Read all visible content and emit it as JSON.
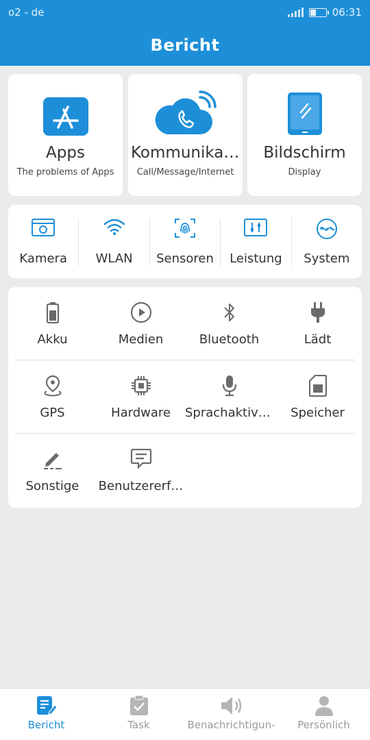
{
  "status_bar": {
    "carrier": "o2 - de",
    "time": "06:31",
    "battery_level": 0.35
  },
  "header": {
    "title": "Bericht"
  },
  "top_cards": [
    {
      "title": "Apps",
      "subtitle": "The problems of Apps",
      "icon": "app-store-icon"
    },
    {
      "title": "Kommunikati…",
      "subtitle": "Call/Message/Internet",
      "icon": "cloud-phone-icon"
    },
    {
      "title": "Bildschirm",
      "subtitle": "Display",
      "icon": "tablet-icon"
    }
  ],
  "row_items": [
    {
      "label": "Kamera",
      "icon": "camera-icon"
    },
    {
      "label": "WLAN",
      "icon": "wifi-icon"
    },
    {
      "label": "Sensoren",
      "icon": "fingerprint-icon"
    },
    {
      "label": "Leistung",
      "icon": "performance-icon"
    },
    {
      "label": "System",
      "icon": "system-icon"
    }
  ],
  "grid_items": [
    {
      "label": "Akku",
      "icon": "battery-icon"
    },
    {
      "label": "Medien",
      "icon": "play-icon"
    },
    {
      "label": "Bluetooth",
      "icon": "bluetooth-icon"
    },
    {
      "label": "Lädt",
      "icon": "plug-icon"
    },
    {
      "label": "GPS",
      "icon": "location-icon"
    },
    {
      "label": "Hardware",
      "icon": "chip-icon"
    },
    {
      "label": "Sprachaktivi…",
      "icon": "microphone-icon"
    },
    {
      "label": "Speicher",
      "icon": "sd-card-icon"
    },
    {
      "label": "Sonstige",
      "icon": "pencil-icon"
    },
    {
      "label": "Benutzererf…",
      "icon": "feedback-icon"
    }
  ],
  "bottom_nav": [
    {
      "label": "Bericht",
      "icon": "report-icon",
      "active": true
    },
    {
      "label": "Task",
      "icon": "clipboard-check-icon",
      "active": false
    },
    {
      "label": "Benachrichtigun-",
      "icon": "speaker-icon",
      "active": false
    },
    {
      "label": "Persönlich",
      "icon": "person-icon",
      "active": false
    }
  ],
  "colors": {
    "accent": "#1d8fd8",
    "icon_gray": "#6b6b6b",
    "background": "#ebebeb"
  }
}
